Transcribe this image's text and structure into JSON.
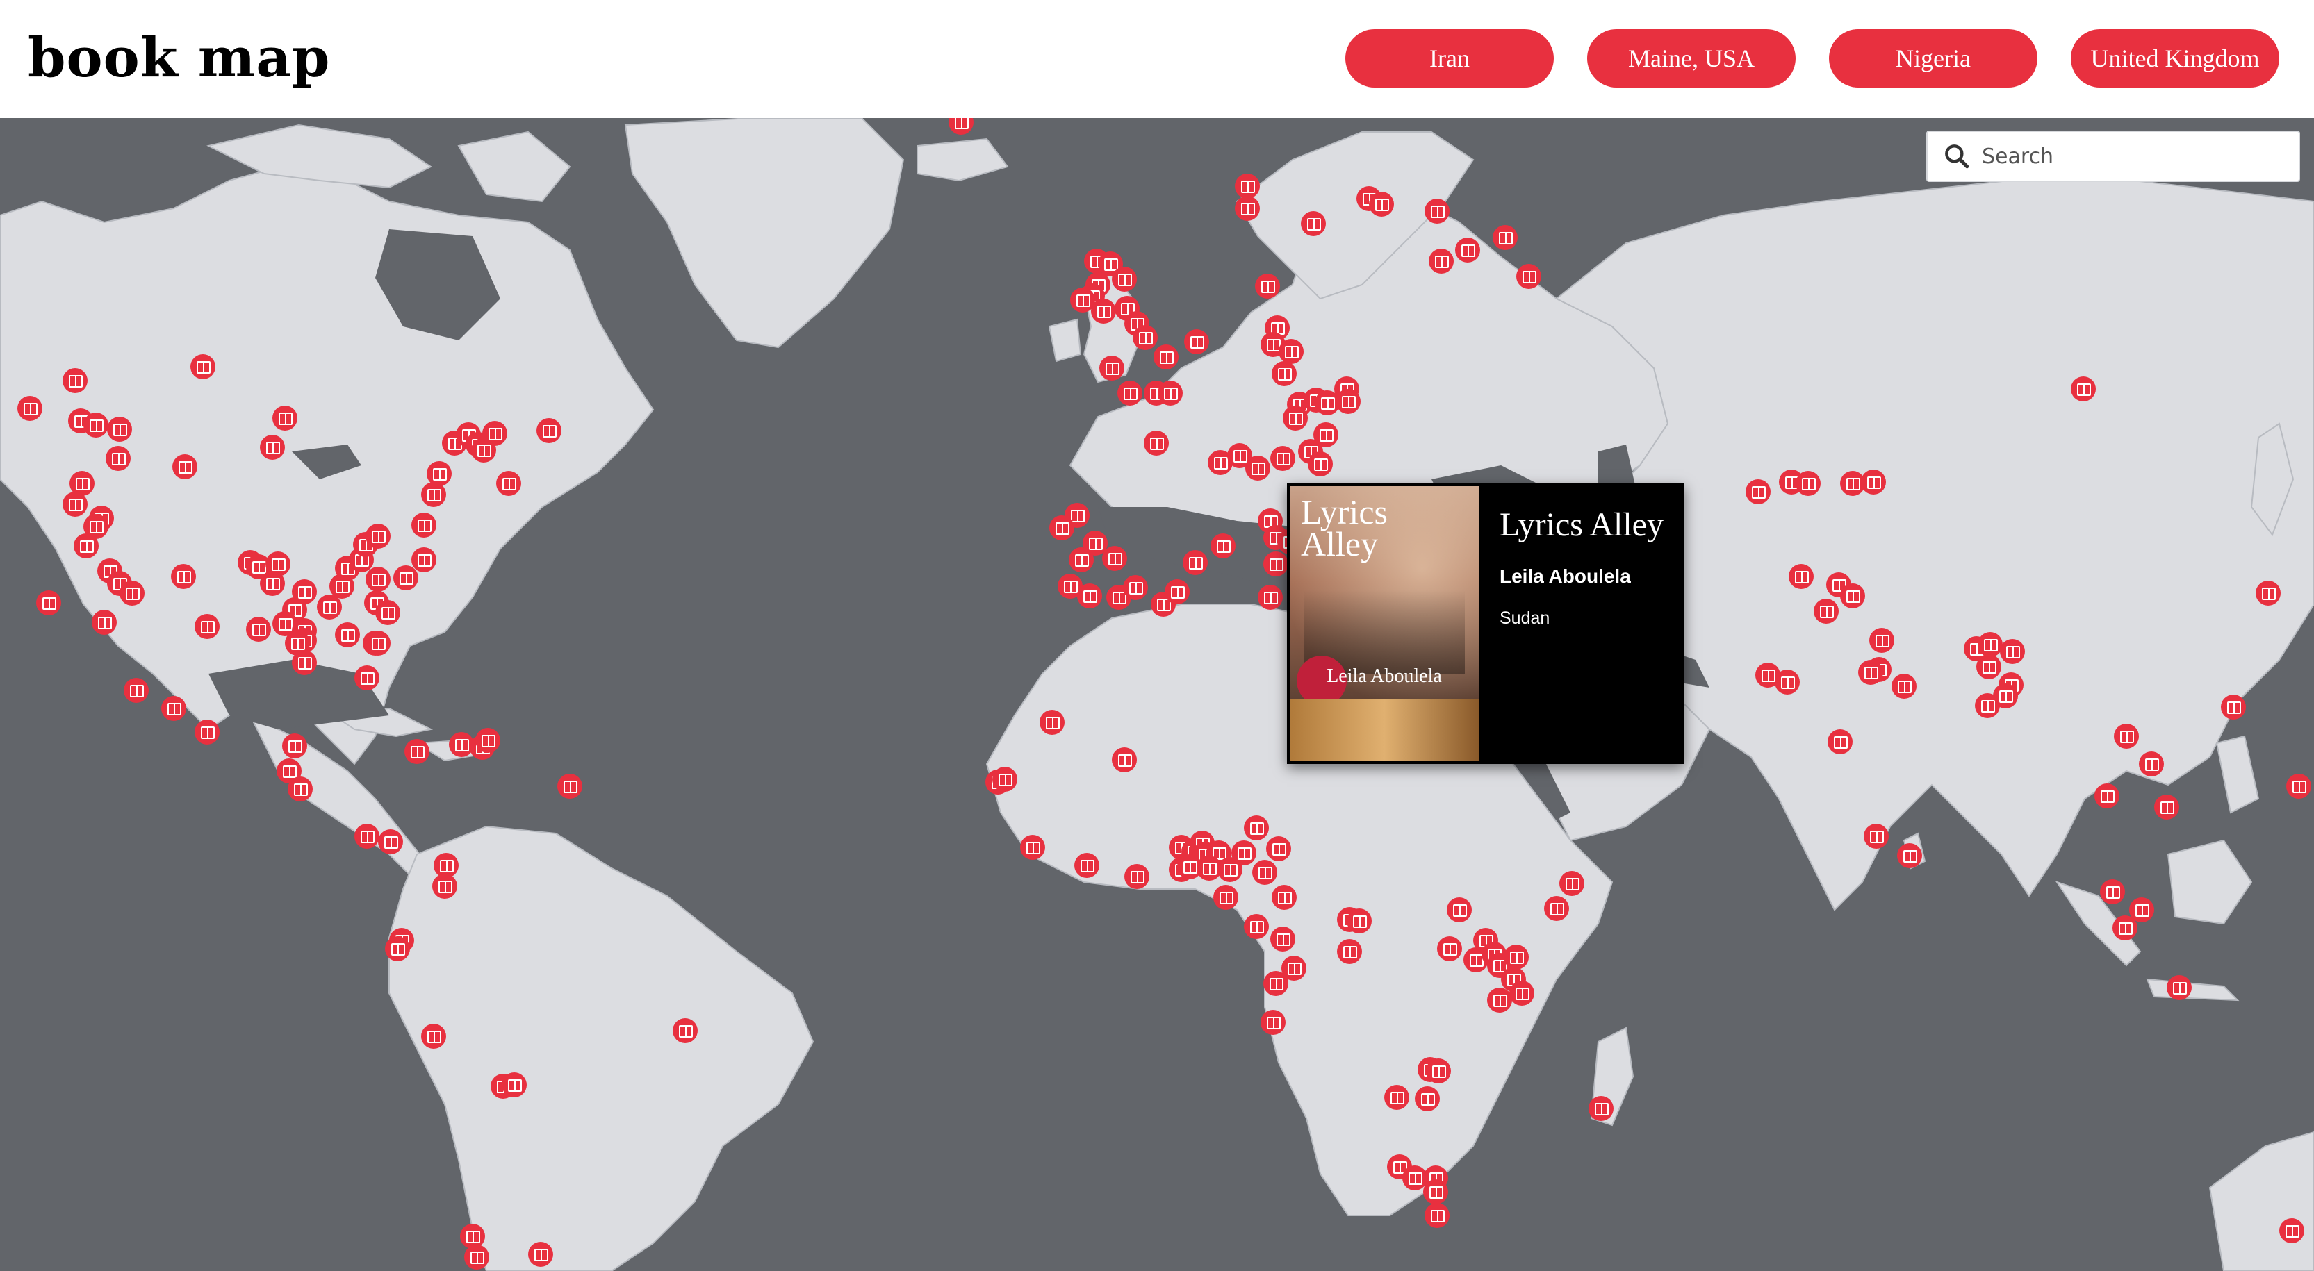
{
  "app": {
    "title": "book map"
  },
  "filters": [
    {
      "label": "Iran"
    },
    {
      "label": "Maine, USA"
    },
    {
      "label": "Nigeria"
    },
    {
      "label": "United Kingdom"
    }
  ],
  "search": {
    "placeholder": "Search",
    "value": ""
  },
  "popup": {
    "title": "Lyrics Alley",
    "author": "Leila Aboulela",
    "country": "Sudan",
    "cover": {
      "title": "Lyrics Alley",
      "author": "Leila Aboulela"
    }
  },
  "colors": {
    "accent": "#e8303f",
    "ocean": "#62656a",
    "land": "#dcdde1",
    "popup_bg": "#000000"
  },
  "marker_icon": "book-icon"
}
